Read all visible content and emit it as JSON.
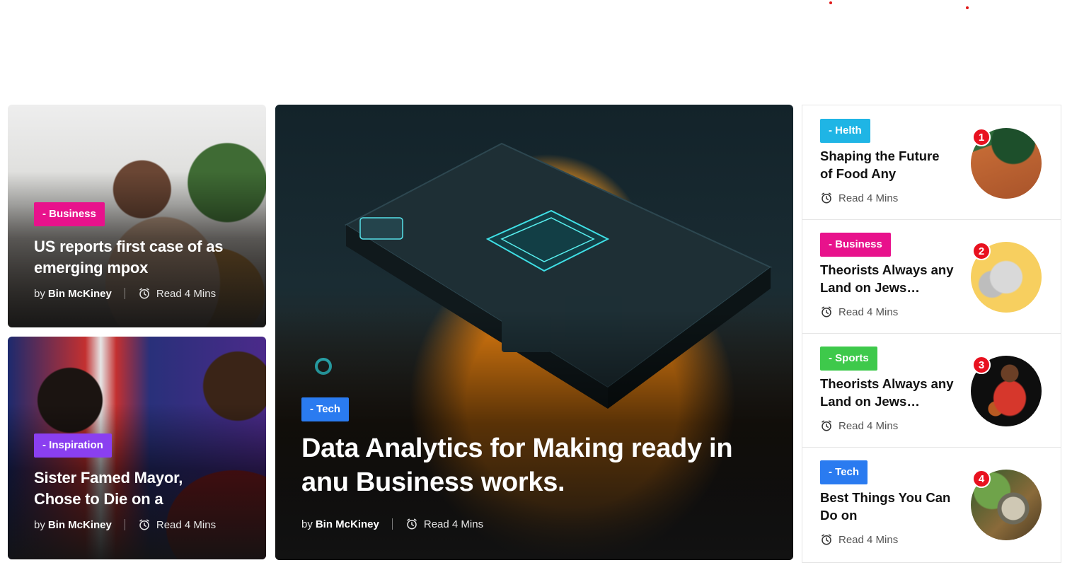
{
  "colors": {
    "business": "#e8128c",
    "inspiration": "#8a3ff0",
    "tech": "#2a7bf0",
    "health": "#1fb5e5",
    "sports": "#3ec94b",
    "rank": "#e8111f"
  },
  "icons": {
    "clock": "alarm-clock-icon"
  },
  "cards": [
    {
      "category": "- Business",
      "title": "US reports first case of as emerging mpox",
      "by": "by",
      "author": "Bin McKiney",
      "read": "Read 4 Mins"
    },
    {
      "category": "- Inspiration",
      "title": "Sister Famed Mayor, Chose to Die on a",
      "by": "by",
      "author": "Bin McKiney",
      "read": "Read 4 Mins"
    }
  ],
  "hero": {
    "category": "- Tech",
    "title": "Data Analytics for Making ready in anu Business works.",
    "by": "by",
    "author": "Bin McKiney",
    "read": "Read 4 Mins"
  },
  "sidebar": [
    {
      "rank": "1",
      "category": "- Helth",
      "title": "Shaping the Future of Food Any",
      "read": "Read 4 Mins"
    },
    {
      "rank": "2",
      "category": "- Business",
      "title": "Theorists Always any Land on Jews…",
      "read": "Read 4 Mins"
    },
    {
      "rank": "3",
      "category": "- Sports",
      "title": "Theorists Always any Land on Jews…",
      "read": "Read 4 Mins"
    },
    {
      "rank": "4",
      "category": "- Tech",
      "title": "Best Things You Can Do on",
      "read": "Read 4 Mins"
    }
  ]
}
